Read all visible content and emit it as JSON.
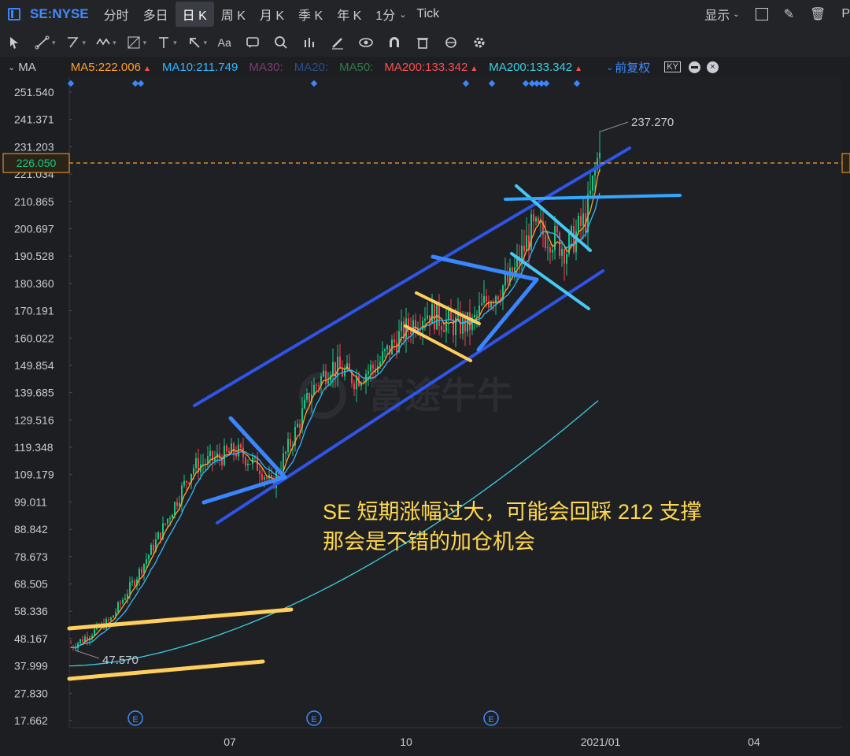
{
  "toolbar": {
    "symbol": "SE:NYSE",
    "timeframes": [
      "分时",
      "多日",
      "日 K",
      "周 K",
      "月 K",
      "季 K",
      "年 K",
      "1分",
      "Tick"
    ],
    "active_timeframe": "日 K",
    "display_label": "显示",
    "right_cut": "P"
  },
  "ma_row": {
    "label": "MA",
    "items": [
      {
        "text": "MA5:222.006",
        "color": "#ff9f2e",
        "arrow": true
      },
      {
        "text": "MA10:211.749",
        "color": "#33b7ff",
        "arrow": false
      },
      {
        "text": "MA30:",
        "color": "#7a3e6b",
        "arrow": false
      },
      {
        "text": "MA20:",
        "color": "#2a4f8a",
        "arrow": false
      },
      {
        "text": "MA50:",
        "color": "#2f7a4a",
        "arrow": false
      },
      {
        "text": "MA200:133.342",
        "color": "#ff4d4f",
        "arrow": true
      },
      {
        "text": "MA200:133.342",
        "color": "#3ad1e0",
        "arrow": true
      }
    ],
    "adjust_label": "前复权"
  },
  "chart_data": {
    "type": "candlestick",
    "y_ticks": [
      "251.540",
      "241.371",
      "231.203",
      "221.034",
      "210.865",
      "200.697",
      "190.528",
      "180.360",
      "170.191",
      "160.022",
      "149.854",
      "139.685",
      "129.516",
      "119.348",
      "109.179",
      "99.011",
      "88.842",
      "78.673",
      "68.505",
      "58.336",
      "48.167",
      "37.999",
      "27.830",
      "17.662"
    ],
    "x_ticks": [
      "07",
      "10",
      "2021/01",
      "04"
    ],
    "price_range": [
      17.662,
      251.54
    ],
    "current_price": "226.050",
    "high_label": "237.270",
    "low_label": "47.570",
    "earnings_marker": "E",
    "watermark": "富途牛牛",
    "annotation_lines": [
      "SE 短期涨幅过大，可能会回踩 212 支撑",
      "那会是不错的加仓机会"
    ],
    "colors": {
      "up": "#16c784",
      "down": "#ff3b4e",
      "ma5": "#ff9f2e",
      "ma10": "#33b7ff",
      "ma200": "#3ad1e0",
      "channel": "#2f55e8",
      "accent": "#ffd84d",
      "price_line": "#ff9f2e"
    }
  }
}
